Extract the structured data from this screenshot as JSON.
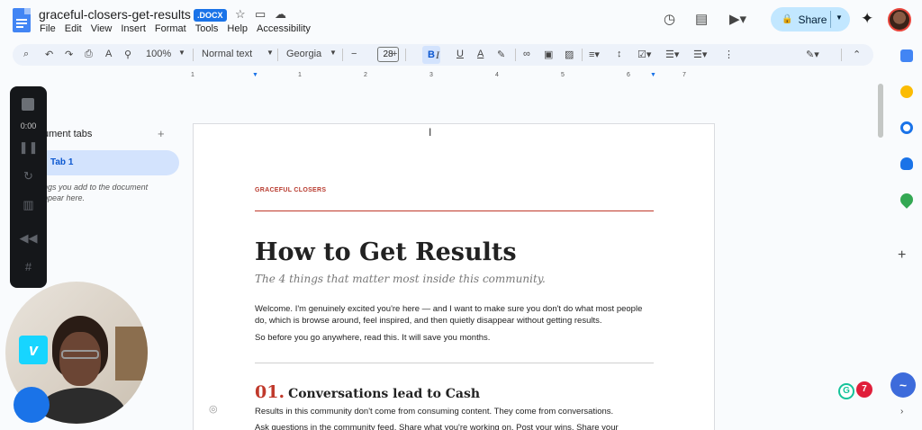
{
  "titlebar": {
    "doc_title": "graceful-closers-get-results",
    "badge": ".DOCX",
    "menu": [
      "File",
      "Edit",
      "View",
      "Insert",
      "Format",
      "Tools",
      "Help",
      "Accessibility"
    ],
    "share_label": "Share"
  },
  "toolbar": {
    "zoom": "100%",
    "style": "Normal text",
    "font": "Georgia",
    "font_size": "28",
    "bold": "B",
    "italic": "I",
    "underline": "U",
    "text_color": "A"
  },
  "ruler": [
    "1",
    "1",
    "2",
    "3",
    "4",
    "5",
    "6",
    "7"
  ],
  "side_panel": {
    "title": "ument tabs",
    "tab_label": "Tab 1",
    "hint": "ngs you add to the document ppear here."
  },
  "recorder": {
    "time": "0:00",
    "vimeo_glyph": "v"
  },
  "document": {
    "eyebrow": "GRACEFUL CLOSERS",
    "heading": "How to Get Results",
    "subheading": "The 4 things that matter most inside this community.",
    "para1": "Welcome. I'm genuinely excited you're here — and I want to make sure you don't do what most people do, which is browse around, feel inspired, and then quietly disappear without getting results.",
    "para2": "So before you go anywhere, read this. It will save you months.",
    "section_num": "01.",
    "section_title": "Conversations lead to Cash",
    "para3": "Results in this community don't come from consuming content. They come from conversations.",
    "para4": "Ask questions in the community feed. Share what you're working on. Post your wins. Share your"
  },
  "colors": {
    "accent_red": "#c0392b",
    "share_bg": "#c2e7ff",
    "tab_bg": "#d3e3fd"
  }
}
